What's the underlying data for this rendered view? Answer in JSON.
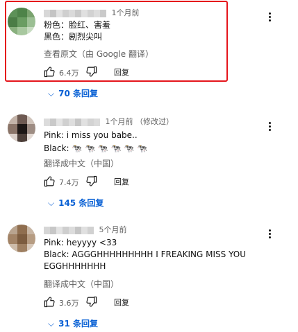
{
  "comments": [
    {
      "time": "1个月前",
      "edited": "",
      "lines": [
        "粉色：脸红、害羞",
        "黑色：剧烈尖叫"
      ],
      "translate_label": "查看原文（由 Google 翻译）",
      "likes": "6.4万",
      "reply_label": "回复",
      "replies_label": "70 条回复",
      "highlighted": true
    },
    {
      "time": "1个月前",
      "edited": "（修改过）",
      "lines": [
        "Pink: i miss you babe..",
        "Black: 🐄 🐄 🐄 🐄 🐄 🐄"
      ],
      "translate_label": "翻译成中文（中国）",
      "likes": "7.4万",
      "reply_label": "回复",
      "replies_label": "145 条回复",
      "highlighted": false
    },
    {
      "time": "5个月前",
      "edited": "",
      "lines": [
        "Pink: heyyyy <33",
        "Black: AGGGHHHHHHHHH I FREAKING MISS YOU",
        "EGGHHHHHHH"
      ],
      "translate_label": "翻译成中文（中国）",
      "likes": "3.6万",
      "reply_label": "回复",
      "replies_label": "31 条回复",
      "highlighted": false
    }
  ],
  "colors": {
    "highlight_border": "#e5141b",
    "link_blue": "#065fd4",
    "meta_gray": "#606060"
  }
}
